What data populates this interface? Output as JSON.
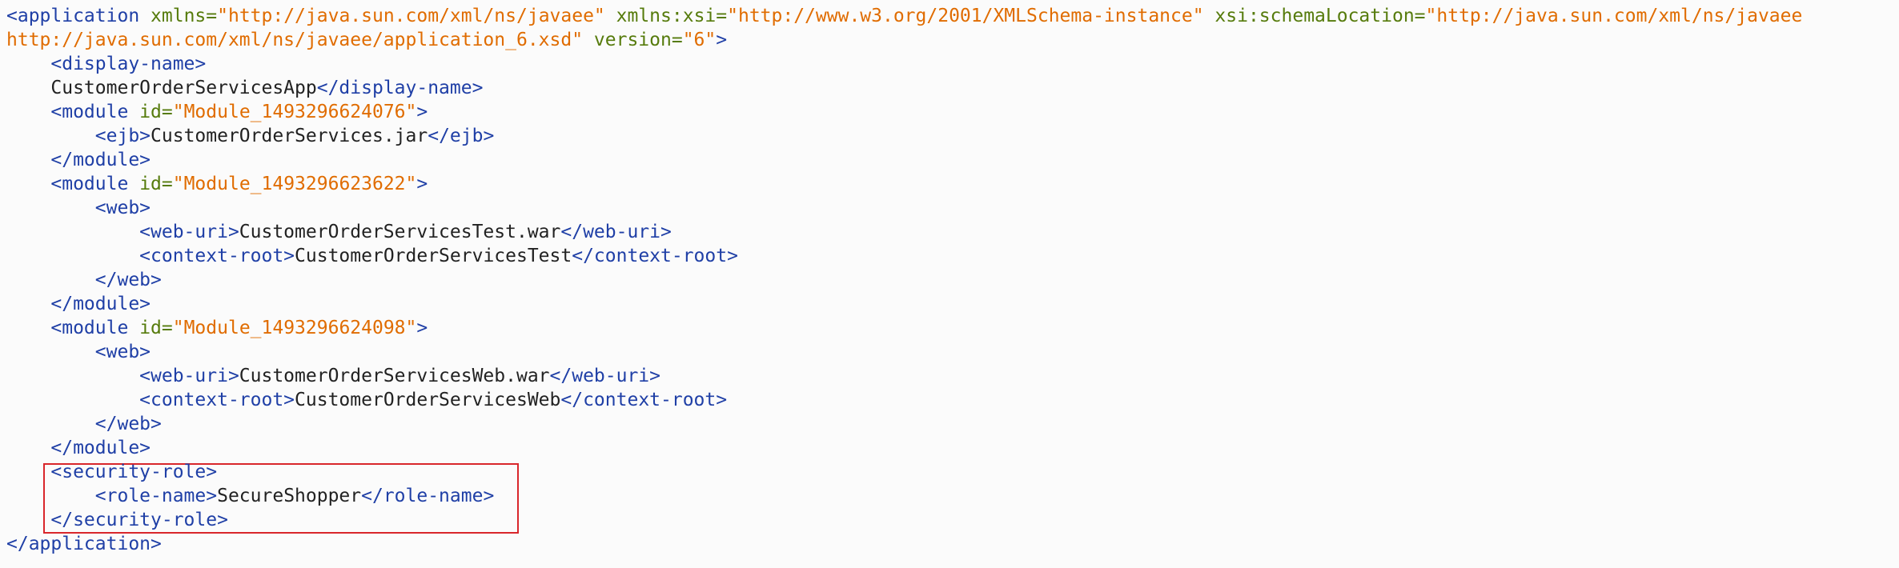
{
  "colors": {
    "tag": "#1f3fa6",
    "attribute": "#567b0c",
    "value": "#e06c00",
    "text": "#222222",
    "highlight_border": "#d9262b",
    "background": "#fbfbfb"
  },
  "xml": {
    "app_open": "<application",
    "xmlns_attr": "xmlns=",
    "xmlns_val": "\"http://java.sun.com/xml/ns/javaee\"",
    "xmlns_xsi_attr": "xmlns:xsi=",
    "xmlns_xsi_val": "\"http://www.w3.org/2001/XMLSchema-instance\"",
    "schema_loc_attr": "xsi:schemaLocation=",
    "schema_loc_val_1": "\"http://java.sun.com/xml/ns/javaee",
    "schema_loc_val_2": "http://java.sun.com/xml/ns/javaee/application_6.xsd\"",
    "version_attr": "version=",
    "version_val": "\"6\"",
    "gt": ">",
    "display_name_open": "<display-name>",
    "display_name_text": "CustomerOrderServicesApp",
    "display_name_close": "</display-name>",
    "module_open": "<module",
    "id_attr": "id=",
    "module1_id": "\"Module_1493296624076\"",
    "ejb_open": "<ejb>",
    "ejb_text": "CustomerOrderServices.jar",
    "ejb_close": "</ejb>",
    "module_close": "</module>",
    "module2_id": "\"Module_1493296623622\"",
    "web_open": "<web>",
    "web_uri_open": "<web-uri>",
    "web_uri_2_text": "CustomerOrderServicesTest.war",
    "web_uri_close": "</web-uri>",
    "context_root_open": "<context-root>",
    "context_root_2_text": "CustomerOrderServicesTest",
    "context_root_close": "</context-root>",
    "web_close": "</web>",
    "module3_id": "\"Module_1493296624098\"",
    "web_uri_3_text": "CustomerOrderServicesWeb.war",
    "context_root_3_text": "CustomerOrderServicesWeb",
    "security_role_open": "<security-role>",
    "role_name_open": "<role-name>",
    "role_name_text": "SecureShopper",
    "role_name_close": "</role-name>",
    "security_role_close": "</security-role>",
    "app_close": "</application>"
  }
}
